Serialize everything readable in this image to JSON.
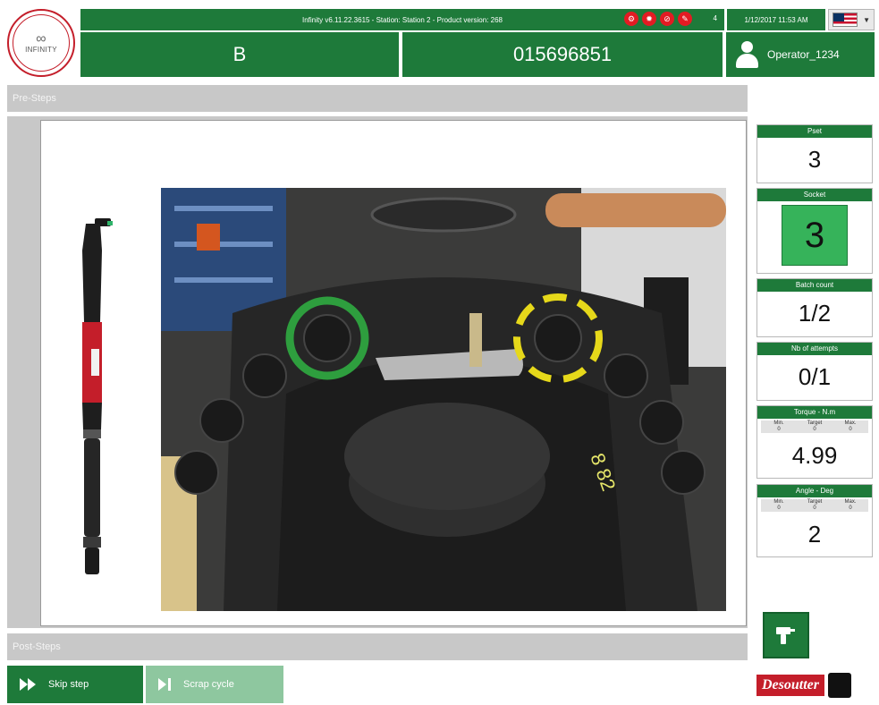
{
  "header": {
    "app_logo_text": "INFINITY",
    "status_text": "Infinity v6.11.22.3615 - Station: Station 2 - Product version: 268",
    "alert_count": "4",
    "datetime": "1/12/2017 11:53 AM",
    "language": "en-US",
    "field_a": "B",
    "serial_number": "015696851",
    "operator": "Operator_1234"
  },
  "steps": {
    "pre_label": "Pre-Steps",
    "post_label": "Post-Steps"
  },
  "widgets": {
    "pset": {
      "label": "Pset",
      "value": "3"
    },
    "socket": {
      "label": "Socket",
      "value": "3"
    },
    "batch": {
      "label": "Batch count",
      "value": "1/2"
    },
    "attempts": {
      "label": "Nb of attempts",
      "value": "0/1"
    },
    "torque": {
      "label": "Torque - N.m",
      "min_label": "Min.",
      "target_label": "Target",
      "max_label": "Max.",
      "min": "0",
      "target": "0",
      "max": "0",
      "value": "4.99"
    },
    "angle": {
      "label": "Angle - Deg",
      "min_label": "Min.",
      "target_label": "Target",
      "max_label": "Max.",
      "min": "0",
      "target": "0",
      "max": "0",
      "value": "2"
    }
  },
  "buttons": {
    "skip_label": "Skip step",
    "scrap_label": "Scrap cycle"
  },
  "brand": {
    "name": "Desoutter"
  },
  "colors": {
    "primary_green": "#1e7a3a",
    "socket_green": "#36b35a",
    "alert_red": "#e31b23",
    "panel_gray": "#c8c8c8",
    "done_ring": "#2e9e3e",
    "pending_ring": "#e6d81a"
  },
  "icons": [
    "user-icon",
    "us-flag-icon",
    "tool-icon",
    "skip-icon",
    "scrap-icon",
    "alert-icons"
  ]
}
